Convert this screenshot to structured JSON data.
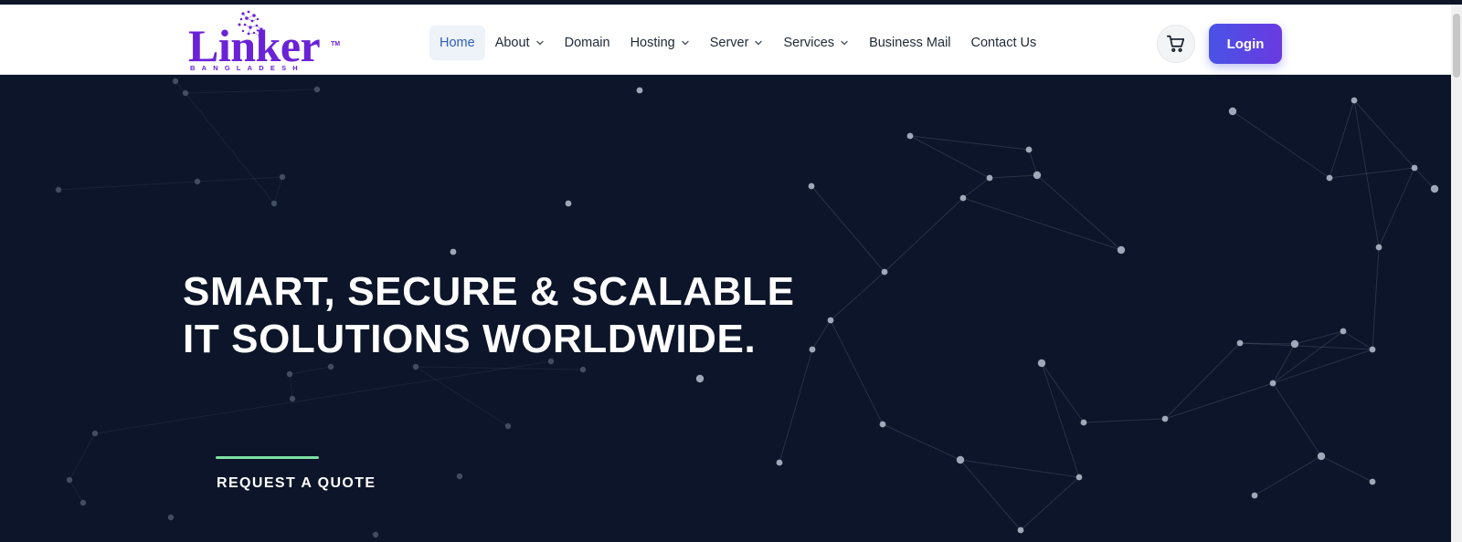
{
  "brand": {
    "name": "Linker",
    "tm": "TM",
    "tagline": "BANGLADESH",
    "color": "#6a22d6"
  },
  "nav": {
    "items": [
      {
        "label": "Home",
        "active": true
      },
      {
        "label": "About",
        "dropdown": true
      },
      {
        "label": "Domain"
      },
      {
        "label": "Hosting",
        "dropdown": true
      },
      {
        "label": "Server",
        "dropdown": true
      },
      {
        "label": "Services",
        "dropdown": true
      },
      {
        "label": "Business Mail"
      },
      {
        "label": "Contact Us"
      }
    ]
  },
  "actions": {
    "cart_icon": "cart-icon",
    "login_label": "Login",
    "login_color": "#4953e6"
  },
  "hero": {
    "title_line1": "SMART, SECURE & SCALABLE",
    "title_line2": "IT SOLUTIONS WORLDWIDE.",
    "cta_label": "REQUEST A QUOTE",
    "background": "#0c1529",
    "accent": "#7ee0a3"
  }
}
